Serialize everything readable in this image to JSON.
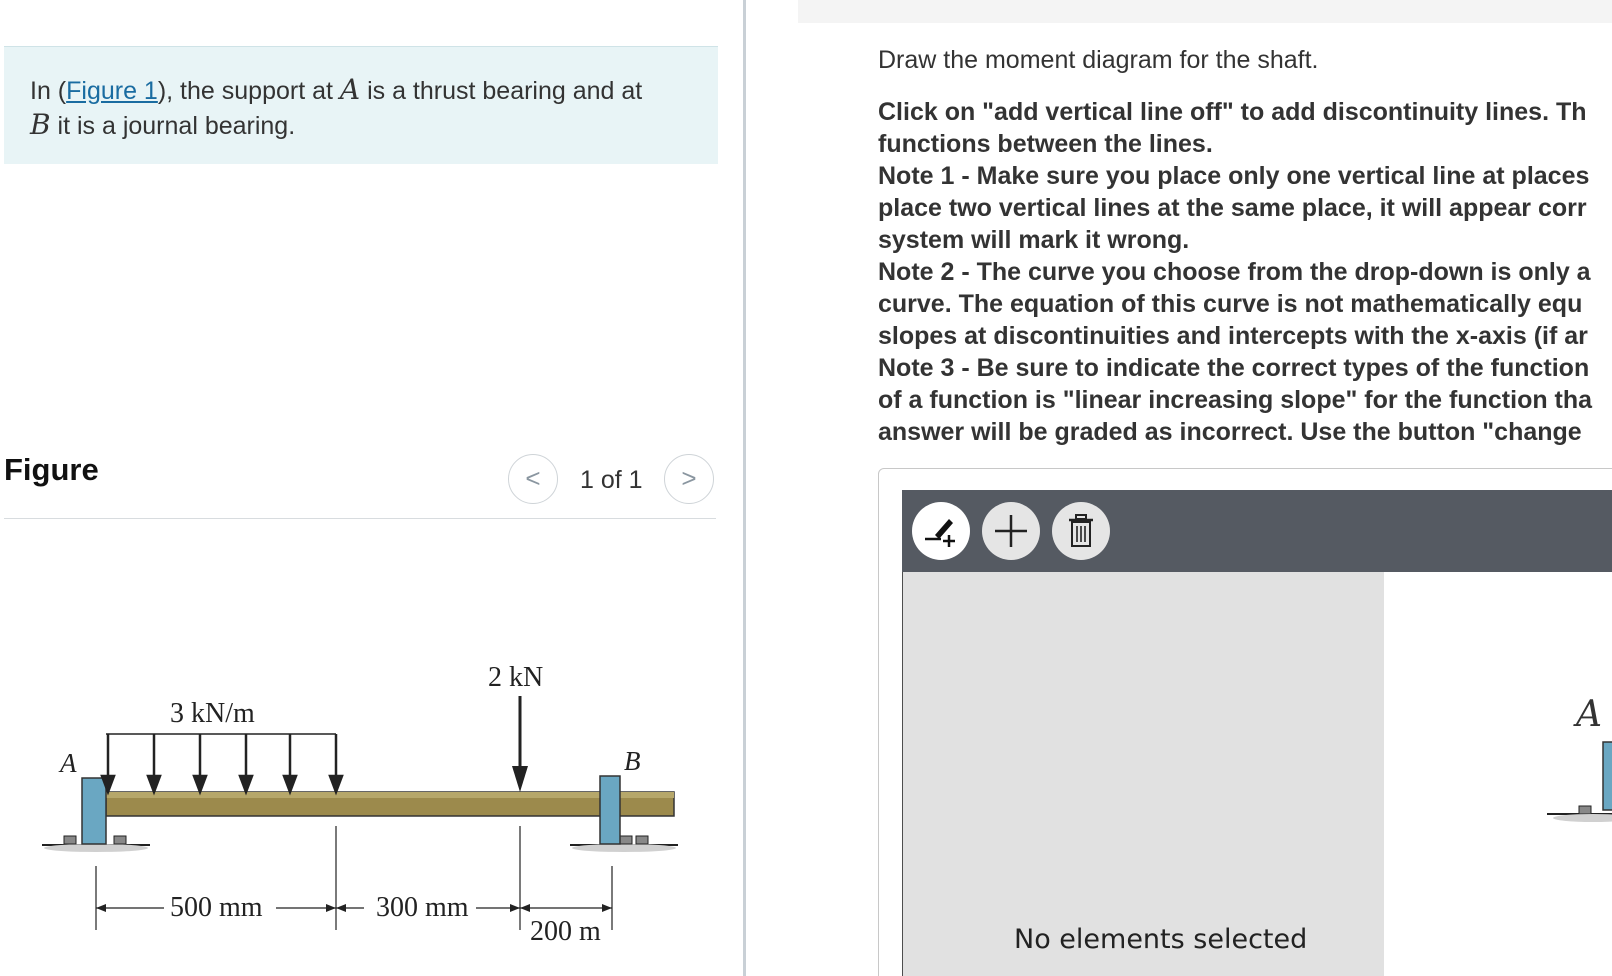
{
  "intro": {
    "prefix": "In (",
    "figure_link": "Figure 1",
    "middle": "), the support at ",
    "point_a": "A",
    "after_a": " is a thrust bearing and at",
    "point_b": "B",
    "after_b": " it is a journal bearing."
  },
  "figure": {
    "heading": "Figure",
    "pager_prev": "<",
    "pager_next": ">",
    "pager_count": "1 of 1"
  },
  "diagram": {
    "label_a": "A",
    "label_b": "B",
    "distributed_load": "3 kN/m",
    "point_load": "2 kN",
    "dim_1": "500 mm",
    "dim_2": "300 mm",
    "dim_3": "200 m"
  },
  "instructions": {
    "prompt": "Draw the moment diagram for the shaft.",
    "lines": [
      "Click on \"add vertical line off\" to add discontinuity lines. Th",
      "functions between the lines.",
      "Note 1 - Make sure you place only one vertical line at places",
      "place two vertical lines at the same place, it will appear corr",
      "system will mark it wrong.",
      "Note 2 - The curve you choose from the drop-down is only a",
      "curve. The equation of this curve is not mathematically equ",
      "slopes at discontinuities and intercepts with the x-axis (if ar",
      "Note 3 - Be sure to indicate the correct types of the function",
      "of a function is \"linear increasing slope\" for the function tha",
      "answer will be graded as incorrect. Use the button \"change"
    ]
  },
  "tool": {
    "status": "No elements selected",
    "canvas_label": "A"
  },
  "colors": {
    "intro_bg": "#e8f4f6",
    "link": "#1a6ca1",
    "toolbar": "#555a62",
    "canvas": "#e1e1e1",
    "beam": "#9c8a4c",
    "support": "#6aa7c2"
  },
  "icons": {
    "draw_tool": "pen-plus-icon",
    "add_tool": "plus-icon",
    "delete_tool": "trash-icon"
  }
}
